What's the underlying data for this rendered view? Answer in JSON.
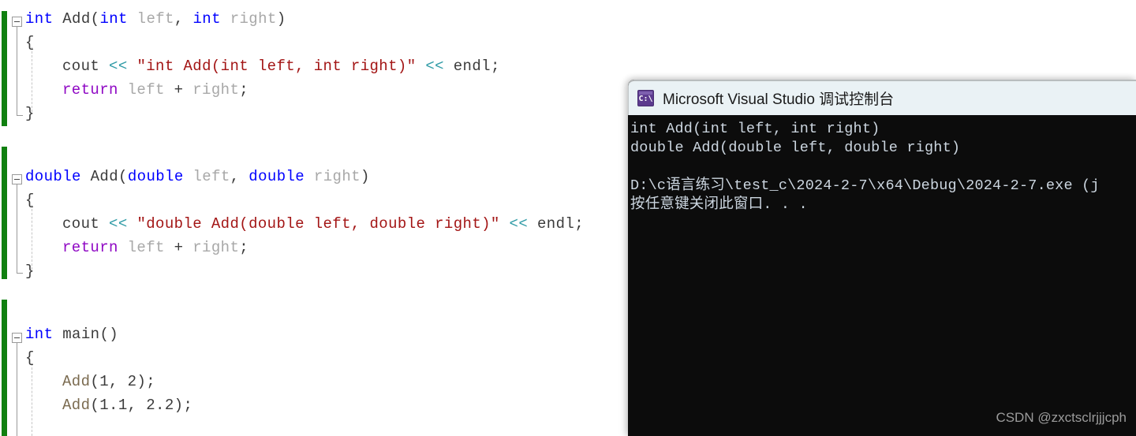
{
  "editor": {
    "name": "visual-studio-code-editor",
    "background": "#ffffff",
    "change_bar_color": "#108010",
    "colors": {
      "keyword": "#0000ff",
      "control_keyword": "#8f08c4",
      "identifier": "#3b3b3b",
      "parameter": "#a8a8a8",
      "string_literal": "#a31515",
      "stream_operator": "#2f9ba6",
      "function_call": "#7a6a4f"
    },
    "blocks": [
      {
        "name": "int-add-function",
        "lines": [
          {
            "indent": 0,
            "tokens": [
              {
                "t": "int",
                "c": "kw"
              },
              {
                "t": " ",
                "c": "punct"
              },
              {
                "t": "Add",
                "c": "ident"
              },
              {
                "t": "(",
                "c": "punct"
              },
              {
                "t": "int",
                "c": "kw"
              },
              {
                "t": " ",
                "c": "punct"
              },
              {
                "t": "left",
                "c": "param"
              },
              {
                "t": ", ",
                "c": "punct"
              },
              {
                "t": "int",
                "c": "kw"
              },
              {
                "t": " ",
                "c": "punct"
              },
              {
                "t": "right",
                "c": "param"
              },
              {
                "t": ")",
                "c": "punct"
              }
            ]
          },
          {
            "indent": 0,
            "tokens": [
              {
                "t": "{",
                "c": "punct"
              }
            ]
          },
          {
            "indent": 1,
            "tokens": [
              {
                "t": "cout",
                "c": "ident"
              },
              {
                "t": " ",
                "c": "punct"
              },
              {
                "t": "<<",
                "c": "op"
              },
              {
                "t": " ",
                "c": "punct"
              },
              {
                "t": "\"int Add(int left, int right)\"",
                "c": "str"
              },
              {
                "t": " ",
                "c": "punct"
              },
              {
                "t": "<<",
                "c": "op"
              },
              {
                "t": " ",
                "c": "punct"
              },
              {
                "t": "endl",
                "c": "ident"
              },
              {
                "t": ";",
                "c": "punct"
              }
            ]
          },
          {
            "indent": 1,
            "tokens": [
              {
                "t": "return",
                "c": "ctl"
              },
              {
                "t": " ",
                "c": "punct"
              },
              {
                "t": "left",
                "c": "param"
              },
              {
                "t": " + ",
                "c": "punct"
              },
              {
                "t": "right",
                "c": "param"
              },
              {
                "t": ";",
                "c": "punct"
              }
            ]
          },
          {
            "indent": 0,
            "tokens": [
              {
                "t": "}",
                "c": "punct"
              }
            ]
          }
        ]
      },
      {
        "name": "double-add-function",
        "lines": [
          {
            "indent": 0,
            "tokens": [
              {
                "t": "double",
                "c": "kw"
              },
              {
                "t": " ",
                "c": "punct"
              },
              {
                "t": "Add",
                "c": "ident"
              },
              {
                "t": "(",
                "c": "punct"
              },
              {
                "t": "double",
                "c": "kw"
              },
              {
                "t": " ",
                "c": "punct"
              },
              {
                "t": "left",
                "c": "param"
              },
              {
                "t": ", ",
                "c": "punct"
              },
              {
                "t": "double",
                "c": "kw"
              },
              {
                "t": " ",
                "c": "punct"
              },
              {
                "t": "right",
                "c": "param"
              },
              {
                "t": ")",
                "c": "punct"
              }
            ]
          },
          {
            "indent": 0,
            "tokens": [
              {
                "t": "{",
                "c": "punct"
              }
            ]
          },
          {
            "indent": 1,
            "tokens": [
              {
                "t": "cout",
                "c": "ident"
              },
              {
                "t": " ",
                "c": "punct"
              },
              {
                "t": "<<",
                "c": "op"
              },
              {
                "t": " ",
                "c": "punct"
              },
              {
                "t": "\"double Add(double left, double right)\"",
                "c": "str"
              },
              {
                "t": " ",
                "c": "punct"
              },
              {
                "t": "<<",
                "c": "op"
              },
              {
                "t": " ",
                "c": "punct"
              },
              {
                "t": "endl",
                "c": "ident"
              },
              {
                "t": ";",
                "c": "punct"
              }
            ]
          },
          {
            "indent": 1,
            "tokens": [
              {
                "t": "return",
                "c": "ctl"
              },
              {
                "t": " ",
                "c": "punct"
              },
              {
                "t": "left",
                "c": "param"
              },
              {
                "t": " + ",
                "c": "punct"
              },
              {
                "t": "right",
                "c": "param"
              },
              {
                "t": ";",
                "c": "punct"
              }
            ]
          },
          {
            "indent": 0,
            "tokens": [
              {
                "t": "}",
                "c": "punct"
              }
            ]
          }
        ]
      },
      {
        "name": "main-function",
        "lines": [
          {
            "indent": 0,
            "tokens": [
              {
                "t": "int",
                "c": "kw"
              },
              {
                "t": " ",
                "c": "punct"
              },
              {
                "t": "main",
                "c": "ident"
              },
              {
                "t": "()",
                "c": "punct"
              }
            ]
          },
          {
            "indent": 0,
            "tokens": [
              {
                "t": "{",
                "c": "punct"
              }
            ]
          },
          {
            "indent": 1,
            "tokens": [
              {
                "t": "Add",
                "c": "call"
              },
              {
                "t": "(",
                "c": "punct"
              },
              {
                "t": "1",
                "c": "num"
              },
              {
                "t": ", ",
                "c": "punct"
              },
              {
                "t": "2",
                "c": "num"
              },
              {
                "t": ")",
                "c": "punct"
              },
              {
                "t": ";",
                "c": "punct"
              }
            ]
          },
          {
            "indent": 1,
            "tokens": [
              {
                "t": "Add",
                "c": "call"
              },
              {
                "t": "(",
                "c": "punct"
              },
              {
                "t": "1.1",
                "c": "num"
              },
              {
                "t": ", ",
                "c": "punct"
              },
              {
                "t": "2.2",
                "c": "num"
              },
              {
                "t": ")",
                "c": "punct"
              },
              {
                "t": ";",
                "c": "punct"
              }
            ]
          }
        ]
      }
    ]
  },
  "console_window": {
    "title": "Microsoft Visual Studio 调试控制台",
    "icon": "console-cmd-icon",
    "icon_glyph": "C:\\",
    "titlebar_color": "#eaf2f5",
    "background_color": "#0c0c0c",
    "text_color": "#ccd6e0",
    "lines": [
      "int Add(int left, int right)",
      "double Add(double left, double right)",
      "",
      "D:\\c语言练习\\test_c\\2024-2-7\\x64\\Debug\\2024-2-7.exe (j",
      "按任意键关闭此窗口. . ."
    ]
  },
  "watermark": {
    "text": "CSDN @zxctsclrjjjcph"
  }
}
